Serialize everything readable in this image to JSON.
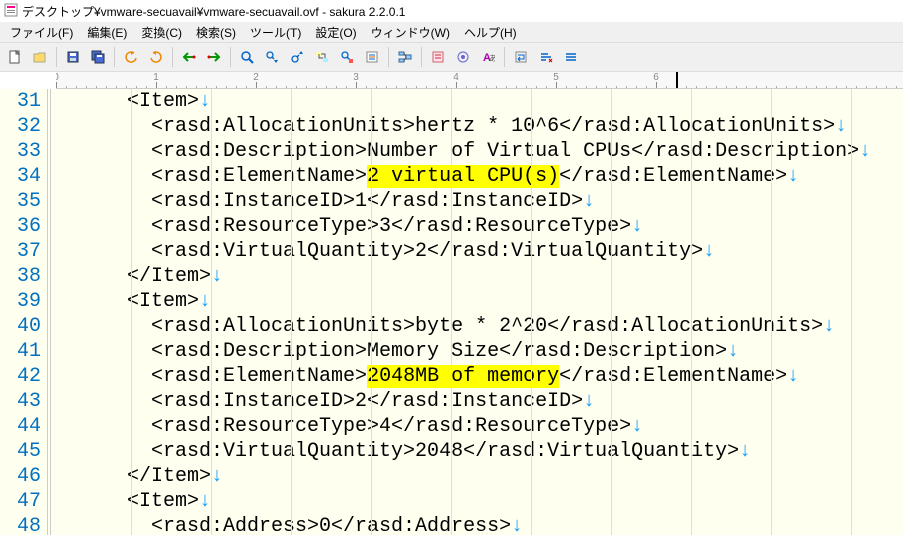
{
  "titlebar": {
    "title": "デスクトップ¥vmware-secuavail¥vmware-secuavail.ovf - sakura 2.2.0.1"
  },
  "menus": {
    "file": "ファイル(F)",
    "edit": "編集(E)",
    "conv": "変換(C)",
    "search": "検索(S)",
    "tool": "ツール(T)",
    "setting": "設定(O)",
    "window": "ウィンドウ(W)",
    "help": "ヘルプ(H)"
  },
  "lines": [
    {
      "n": 31,
      "seg": [
        {
          "t": "      <Item>"
        }
      ]
    },
    {
      "n": 32,
      "seg": [
        {
          "t": "        <rasd:AllocationUnits>hertz * 10^6</rasd:AllocationUnits>"
        }
      ]
    },
    {
      "n": 33,
      "seg": [
        {
          "t": "        <rasd:Description>Number of Virtual CPUs</rasd:Description>"
        }
      ]
    },
    {
      "n": 34,
      "seg": [
        {
          "t": "        <rasd:ElementName>"
        },
        {
          "t": "2 virtual CPU(s)",
          "hl": true
        },
        {
          "t": "</rasd:ElementName>"
        }
      ]
    },
    {
      "n": 35,
      "seg": [
        {
          "t": "        <rasd:InstanceID>1</rasd:InstanceID>"
        }
      ]
    },
    {
      "n": 36,
      "seg": [
        {
          "t": "        <rasd:ResourceType>3</rasd:ResourceType>"
        }
      ]
    },
    {
      "n": 37,
      "seg": [
        {
          "t": "        <rasd:VirtualQuantity>2</rasd:VirtualQuantity>"
        }
      ]
    },
    {
      "n": 38,
      "seg": [
        {
          "t": "      </Item>"
        }
      ]
    },
    {
      "n": 39,
      "seg": [
        {
          "t": "      <Item>"
        }
      ]
    },
    {
      "n": 40,
      "seg": [
        {
          "t": "        <rasd:AllocationUnits>byte * 2^20</rasd:AllocationUnits>"
        }
      ]
    },
    {
      "n": 41,
      "seg": [
        {
          "t": "        <rasd:Description>Memory Size</rasd:Description>"
        }
      ]
    },
    {
      "n": 42,
      "seg": [
        {
          "t": "        <rasd:ElementName>"
        },
        {
          "t": "2048MB of memory",
          "hl": true
        },
        {
          "t": "</rasd:ElementName>"
        }
      ]
    },
    {
      "n": 43,
      "seg": [
        {
          "t": "        <rasd:InstanceID>2</rasd:InstanceID>"
        }
      ]
    },
    {
      "n": 44,
      "seg": [
        {
          "t": "        <rasd:ResourceType>4</rasd:ResourceType>"
        }
      ]
    },
    {
      "n": 45,
      "seg": [
        {
          "t": "        <rasd:VirtualQuantity>2048</rasd:VirtualQuantity>"
        }
      ]
    },
    {
      "n": 46,
      "seg": [
        {
          "t": "      </Item>"
        }
      ]
    },
    {
      "n": 47,
      "seg": [
        {
          "t": "      <Item>"
        }
      ]
    },
    {
      "n": 48,
      "seg": [
        {
          "t": "        <rasd:Address>0</rasd:Address>"
        }
      ]
    }
  ],
  "ruler": {
    "majors": [
      0,
      1,
      2,
      3,
      4,
      5,
      6
    ],
    "posCol": 6.2
  }
}
